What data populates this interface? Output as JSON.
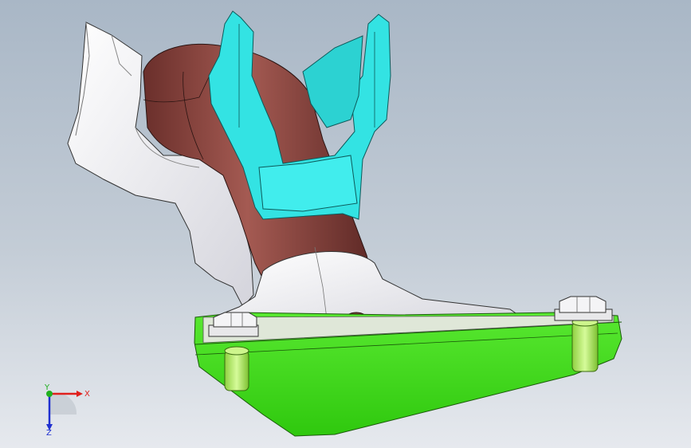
{
  "viewport": {
    "background_top": "#a9b7c6",
    "background_bottom": "#e6e9ee"
  },
  "model": {
    "parts": [
      {
        "name": "mounting-bracket",
        "color": "#f2f2f6"
      },
      {
        "name": "exhaust-pipe",
        "color": "#8e4a44"
      },
      {
        "name": "heat-shield",
        "color": "#33e3e3"
      },
      {
        "name": "base-plate",
        "color": "#3ddc1e"
      },
      {
        "name": "hex-bolt",
        "color": "#b9f06a"
      }
    ]
  },
  "triad": {
    "x_label": "X",
    "y_label": "Y",
    "z_label": "Z",
    "x_color": "#e0201c",
    "y_color": "#20b020",
    "z_color": "#2030d0"
  }
}
